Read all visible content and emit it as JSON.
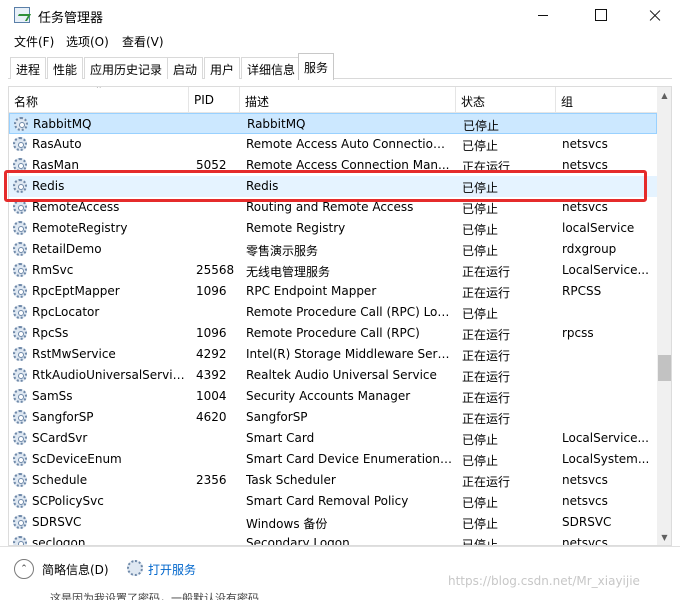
{
  "window": {
    "title": "任务管理器"
  },
  "menu": [
    "文件(F)",
    "选项(O)",
    "查看(V)"
  ],
  "tabs": [
    "进程",
    "性能",
    "应用历史记录",
    "启动",
    "用户",
    "详细信息",
    "服务"
  ],
  "active_tab": "服务",
  "columns": [
    "名称",
    "PID",
    "描述",
    "状态",
    "组"
  ],
  "rows": [
    {
      "name": "RabbitMQ",
      "pid": "",
      "desc": "RabbitMQ",
      "status": "已停止",
      "group": ""
    },
    {
      "name": "RasAuto",
      "pid": "",
      "desc": "Remote Access Auto Connection ...",
      "status": "已停止",
      "group": "netsvcs"
    },
    {
      "name": "RasMan",
      "pid": "5052",
      "desc": "Remote Access Connection Man...",
      "status": "正在运行",
      "group": "netsvcs"
    },
    {
      "name": "Redis",
      "pid": "",
      "desc": "Redis",
      "status": "已停止",
      "group": ""
    },
    {
      "name": "RemoteAccess",
      "pid": "",
      "desc": "Routing and Remote Access",
      "status": "已停止",
      "group": "netsvcs"
    },
    {
      "name": "RemoteRegistry",
      "pid": "",
      "desc": "Remote Registry",
      "status": "已停止",
      "group": "localService"
    },
    {
      "name": "RetailDemo",
      "pid": "",
      "desc": "零售演示服务",
      "status": "已停止",
      "group": "rdxgroup"
    },
    {
      "name": "RmSvc",
      "pid": "25568",
      "desc": "无线电管理服务",
      "status": "正在运行",
      "group": "LocalService..."
    },
    {
      "name": "RpcEptMapper",
      "pid": "1096",
      "desc": "RPC Endpoint Mapper",
      "status": "正在运行",
      "group": "RPCSS"
    },
    {
      "name": "RpcLocator",
      "pid": "",
      "desc": "Remote Procedure Call (RPC) Loc...",
      "status": "已停止",
      "group": ""
    },
    {
      "name": "RpcSs",
      "pid": "1096",
      "desc": "Remote Procedure Call (RPC)",
      "status": "正在运行",
      "group": "rpcss"
    },
    {
      "name": "RstMwService",
      "pid": "4292",
      "desc": "Intel(R) Storage Middleware Serv...",
      "status": "正在运行",
      "group": ""
    },
    {
      "name": "RtkAudioUniversalService",
      "pid": "4392",
      "desc": "Realtek Audio Universal Service",
      "status": "正在运行",
      "group": ""
    },
    {
      "name": "SamSs",
      "pid": "1004",
      "desc": "Security Accounts Manager",
      "status": "正在运行",
      "group": ""
    },
    {
      "name": "SangforSP",
      "pid": "4620",
      "desc": "SangforSP",
      "status": "正在运行",
      "group": ""
    },
    {
      "name": "SCardSvr",
      "pid": "",
      "desc": "Smart Card",
      "status": "已停止",
      "group": "LocalService..."
    },
    {
      "name": "ScDeviceEnum",
      "pid": "",
      "desc": "Smart Card Device Enumeration ...",
      "status": "已停止",
      "group": "LocalSystem..."
    },
    {
      "name": "Schedule",
      "pid": "2356",
      "desc": "Task Scheduler",
      "status": "正在运行",
      "group": "netsvcs"
    },
    {
      "name": "SCPolicySvc",
      "pid": "",
      "desc": "Smart Card Removal Policy",
      "status": "已停止",
      "group": "netsvcs"
    },
    {
      "name": "SDRSVC",
      "pid": "",
      "desc": "Windows 备份",
      "status": "已停止",
      "group": "SDRSVC"
    },
    {
      "name": "seclogon",
      "pid": "",
      "desc": "Secondary Logon",
      "status": "已停止",
      "group": "netsvcs"
    }
  ],
  "footer": {
    "fewer_details": "简略信息(D)",
    "open_services": "打开服务"
  },
  "watermark": "https://blog.csdn.net/Mr_xiayijie",
  "bottom_snippet": "这是因为我设置了密码，一般默认没有密码"
}
